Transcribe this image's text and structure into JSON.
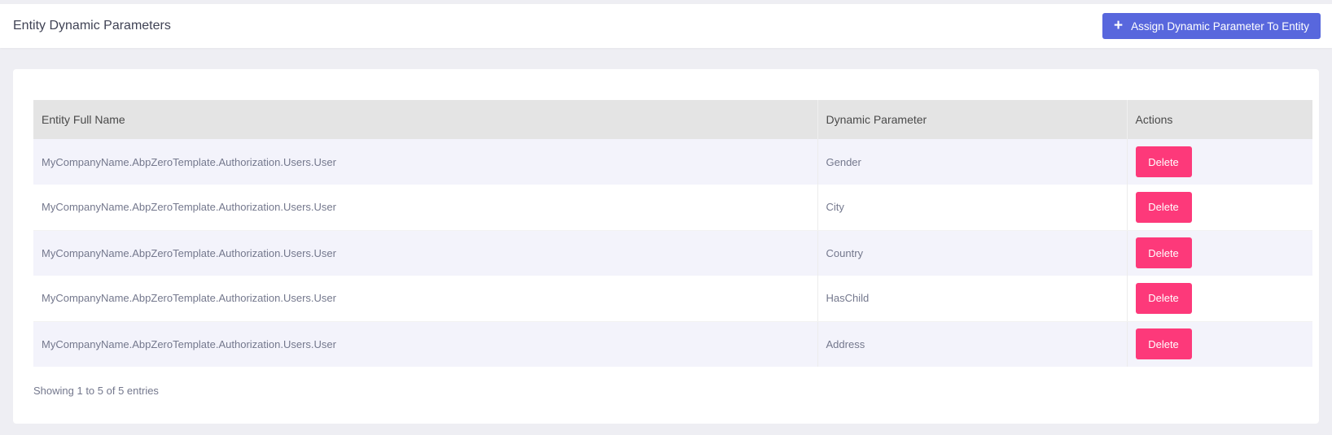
{
  "header": {
    "title": "Entity Dynamic Parameters",
    "assign_button_label": "Assign Dynamic Parameter To Entity",
    "assign_button_icon": "plus-icon"
  },
  "table": {
    "columns": [
      "Entity Full Name",
      "Dynamic Parameter",
      "Actions"
    ],
    "rows": [
      {
        "entity": "MyCompanyName.AbpZeroTemplate.Authorization.Users.User",
        "parameter": "Gender",
        "action": "Delete"
      },
      {
        "entity": "MyCompanyName.AbpZeroTemplate.Authorization.Users.User",
        "parameter": "City",
        "action": "Delete"
      },
      {
        "entity": "MyCompanyName.AbpZeroTemplate.Authorization.Users.User",
        "parameter": "Country",
        "action": "Delete"
      },
      {
        "entity": "MyCompanyName.AbpZeroTemplate.Authorization.Users.User",
        "parameter": "HasChild",
        "action": "Delete"
      },
      {
        "entity": "MyCompanyName.AbpZeroTemplate.Authorization.Users.User",
        "parameter": "Address",
        "action": "Delete"
      }
    ]
  },
  "footer": {
    "info": "Showing 1 to 5 of 5 entries"
  },
  "colors": {
    "primary": "#5867dd",
    "danger": "#fd397a",
    "header_bg": "#e4e4e4",
    "stripe": "#f3f3fb"
  }
}
